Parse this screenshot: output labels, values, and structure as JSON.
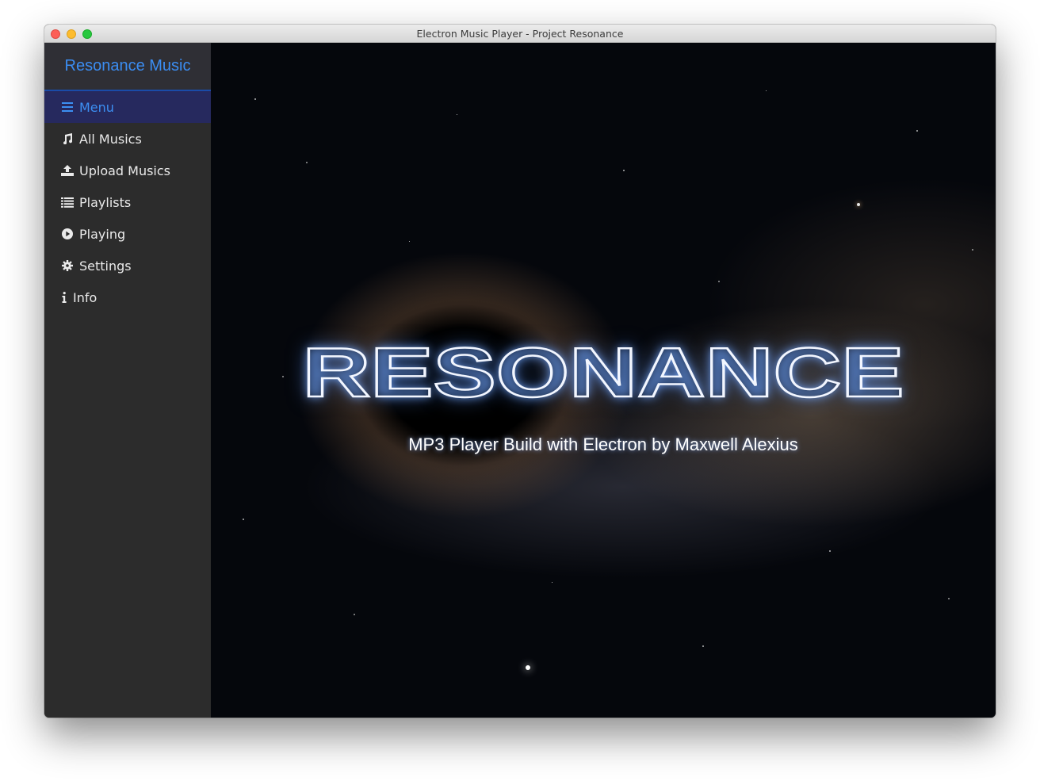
{
  "window": {
    "title": "Electron Music Player - Project Resonance"
  },
  "sidebar": {
    "brand": "Resonance Music",
    "items": [
      {
        "label": "Menu",
        "icon": "hamburger-icon",
        "active": true
      },
      {
        "label": "All Musics",
        "icon": "music-note-icon",
        "active": false
      },
      {
        "label": "Upload Musics",
        "icon": "upload-icon",
        "active": false
      },
      {
        "label": "Playlists",
        "icon": "list-icon",
        "active": false
      },
      {
        "label": "Playing",
        "icon": "play-circle-icon",
        "active": false
      },
      {
        "label": "Settings",
        "icon": "gear-icon",
        "active": false
      },
      {
        "label": "Info",
        "icon": "info-icon",
        "active": false
      }
    ]
  },
  "main": {
    "hero_title": "RESONANCE",
    "subtitle": "MP3 Player Build with Electron by Maxwell Alexius"
  },
  "colors": {
    "accent": "#3b8df2",
    "sidebar_bg": "#2c2c2c",
    "active_bg": "#26295e"
  }
}
